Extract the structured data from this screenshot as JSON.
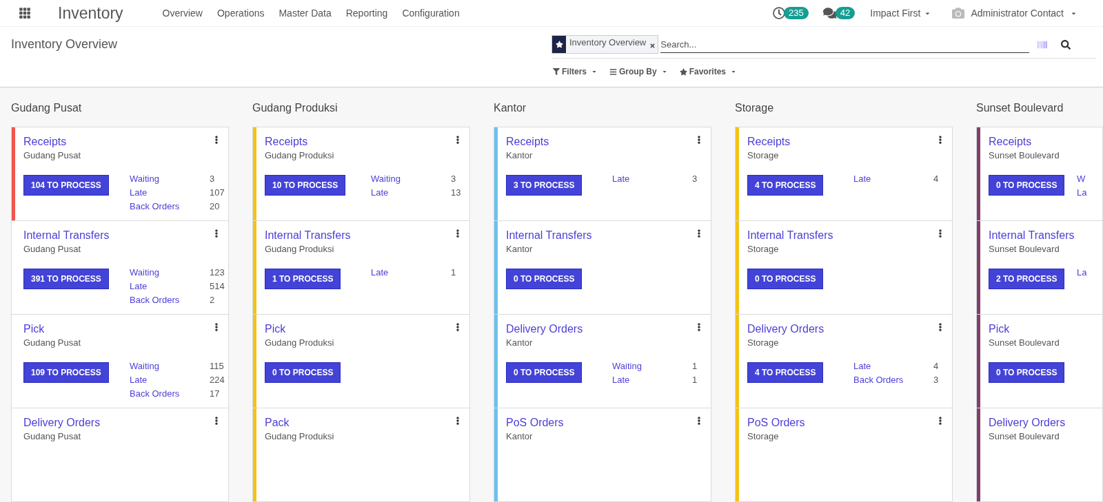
{
  "navbar": {
    "app_name": "Inventory",
    "menus": [
      "Overview",
      "Operations",
      "Master Data",
      "Reporting",
      "Configuration"
    ],
    "activity_count": "235",
    "message_count": "42",
    "company": "Impact First",
    "user": "Administrator Contact"
  },
  "control_panel": {
    "title": "Inventory Overview",
    "facet": "Inventory Overview",
    "search_placeholder": "Search...",
    "filter_buttons": [
      {
        "kind": "filter",
        "label": "Filters"
      },
      {
        "kind": "group",
        "label": "Group By"
      },
      {
        "kind": "favorite",
        "label": "Favorites"
      }
    ]
  },
  "columns": [
    {
      "name": "Gudang Pusat",
      "cards": [
        {
          "title": "Receipts",
          "subtitle": "Gudang Pusat",
          "color": "#f0574b",
          "button": "104 TO PROCESS",
          "stats": [
            {
              "label": "Waiting",
              "count": "3"
            },
            {
              "label": "Late",
              "count": "107"
            },
            {
              "label": "Back Orders",
              "count": "20"
            }
          ]
        },
        {
          "title": "Internal Transfers",
          "subtitle": "Gudang Pusat",
          "button": "391 TO PROCESS",
          "stats": [
            {
              "label": "Waiting",
              "count": "123"
            },
            {
              "label": "Late",
              "count": "514"
            },
            {
              "label": "Back Orders",
              "count": "2"
            }
          ]
        },
        {
          "title": "Pick",
          "subtitle": "Gudang Pusat",
          "button": "109 TO PROCESS",
          "stats": [
            {
              "label": "Waiting",
              "count": "115"
            },
            {
              "label": "Late",
              "count": "224"
            },
            {
              "label": "Back Orders",
              "count": "17"
            }
          ]
        },
        {
          "title": "Delivery Orders",
          "subtitle": "Gudang Pusat"
        }
      ]
    },
    {
      "name": "Gudang Produksi",
      "cards": [
        {
          "title": "Receipts",
          "subtitle": "Gudang Produksi",
          "color": "#f3c316",
          "button": "10 TO PROCESS",
          "stats": [
            {
              "label": "Waiting",
              "count": "3"
            },
            {
              "label": "Late",
              "count": "13"
            }
          ]
        },
        {
          "title": "Internal Transfers",
          "subtitle": "Gudang Produksi",
          "color": "#f3c316",
          "button": "1 TO PROCESS",
          "stats": [
            {
              "label": "Late",
              "count": "1"
            }
          ]
        },
        {
          "title": "Pick",
          "subtitle": "Gudang Produksi",
          "color": "#f3c316",
          "button": "0 TO PROCESS"
        },
        {
          "title": "Pack",
          "subtitle": "Gudang Produksi",
          "color": "#f3c316"
        }
      ]
    },
    {
      "name": "Kantor",
      "cards": [
        {
          "title": "Receipts",
          "subtitle": "Kantor",
          "color": "#6cc1ed",
          "button": "3 TO PROCESS",
          "stats": [
            {
              "label": "Late",
              "count": "3"
            }
          ]
        },
        {
          "title": "Internal Transfers",
          "subtitle": "Kantor",
          "color": "#6cc1ed",
          "button": "0 TO PROCESS"
        },
        {
          "title": "Delivery Orders",
          "subtitle": "Kantor",
          "color": "#6cc1ed",
          "button": "0 TO PROCESS",
          "stats": [
            {
              "label": "Waiting",
              "count": "1"
            },
            {
              "label": "Late",
              "count": "1"
            }
          ]
        },
        {
          "title": "PoS Orders",
          "subtitle": "Kantor",
          "color": "#6cc1ed"
        }
      ]
    },
    {
      "name": "Storage",
      "cards": [
        {
          "title": "Receipts",
          "subtitle": "Storage",
          "color": "#f3c316",
          "button": "4 TO PROCESS",
          "stats": [
            {
              "label": "Late",
              "count": "4"
            }
          ]
        },
        {
          "title": "Internal Transfers",
          "subtitle": "Storage",
          "color": "#f3c316",
          "button": "0 TO PROCESS"
        },
        {
          "title": "Delivery Orders",
          "subtitle": "Storage",
          "color": "#f3c316",
          "button": "4 TO PROCESS",
          "stats": [
            {
              "label": "Late",
              "count": "4"
            },
            {
              "label": "Back Orders",
              "count": "3"
            }
          ]
        },
        {
          "title": "PoS Orders",
          "subtitle": "Storage",
          "color": "#f3c316"
        }
      ]
    },
    {
      "name": "Sunset Boulevard",
      "cards": [
        {
          "title": "Receipts",
          "subtitle": "Sunset Boulevard",
          "color": "#7f4069",
          "button": "0 TO PROCESS",
          "stats": [
            {
              "label": "W"
            },
            {
              "label": "La"
            }
          ]
        },
        {
          "title": "Internal Transfers",
          "subtitle": "Sunset Boulevard",
          "color": "#7f4069",
          "button": "2 TO PROCESS",
          "stats": [
            {
              "label": "La"
            }
          ]
        },
        {
          "title": "Pick",
          "subtitle": "Sunset Boulevard",
          "color": "#7f4069",
          "button": "0 TO PROCESS"
        },
        {
          "title": "Delivery Orders",
          "subtitle": "Sunset Boulevard",
          "color": "#7f4069"
        }
      ]
    }
  ]
}
